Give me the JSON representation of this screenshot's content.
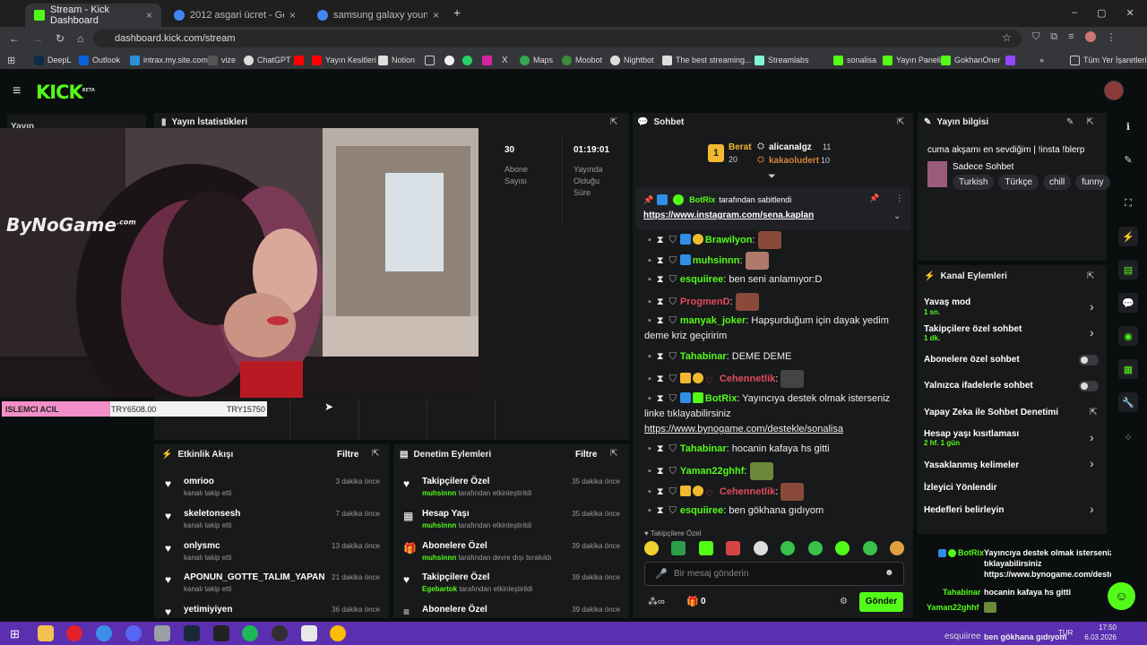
{
  "browser": {
    "tabs": [
      {
        "title": "Stream - Kick Dashboard"
      },
      {
        "title": "2012 asgari ücret - Google'da /"
      },
      {
        "title": "samsung galaxy young - Goog"
      }
    ],
    "url": "dashboard.kick.com/stream",
    "bookmarks": [
      "DeepL",
      "Outlook",
      "intrax.my.site.com",
      "vize",
      "ChatGPT",
      "Yayın Kesitleri",
      "Notion",
      "Maps",
      "Moobot",
      "Nightbot",
      "The best streaming...",
      "Streamlabs",
      "sonalisa",
      "Yayın Paneli",
      "GokhanOner",
      "Tüm Yer İşaretleri"
    ]
  },
  "kick": {
    "logo": "KICK",
    "beta": "BETA"
  },
  "sidebar": {
    "label": "Yayın"
  },
  "stats": {
    "title": "Yayın İstatistikleri",
    "subscribers_value": "30",
    "subscribers_label": "Abone Sayısı",
    "uptime_value": "01:19:01",
    "uptime_label": "Yayında Olduğu Süre"
  },
  "overlay": {
    "brand": "ByNoGame",
    "brand_suffix": ".com",
    "bar_label": "ISLEMCI ACIL",
    "bar_current": "TRY6508.00",
    "bar_goal": "TRY15750",
    "progress": 0.41
  },
  "activity": {
    "title": "Etkinlik Akışı",
    "filter": "Filtre",
    "items": [
      {
        "name": "omrioo",
        "sub": "kanalı takip etti",
        "time": "3 dakika önce"
      },
      {
        "name": "skeletonsesh",
        "sub": "kanalı takip etti",
        "time": "7 dakika önce"
      },
      {
        "name": "onlysmc",
        "sub": "kanalı takip etti",
        "time": "13 dakika önce"
      },
      {
        "name": "APONUN_GOTTE_TALIM_YAPAN",
        "sub": "kanalı takip etti",
        "time": "21 dakika önce"
      },
      {
        "name": "yetimiyiyen",
        "sub": "",
        "time": "36 dakika önce"
      }
    ]
  },
  "moderation": {
    "title": "Denetim Eylemleri",
    "filter": "Filtre",
    "items": [
      {
        "name": "Takipçilere Özel",
        "user": "muhsinnn",
        "sub": "tarafından etkinleştirildi",
        "time": "35 dakika önce"
      },
      {
        "name": "Hesap Yaşı",
        "user": "muhsinnn",
        "sub": "tarafından etkinleştirildi",
        "time": "35 dakika önce"
      },
      {
        "name": "Abonelere Özel",
        "user": "muhsinnn",
        "sub": "tarafından devre dışı bırakıldı",
        "time": "39 dakika önce"
      },
      {
        "name": "Takipçilere Özel",
        "user": "Egebartok",
        "sub": "tarafından etkinleştirildi",
        "time": "39 dakika önce"
      },
      {
        "name": "Abonelere Özel",
        "user": "",
        "sub": "",
        "time": "39 dakika önce"
      }
    ]
  },
  "chat": {
    "title": "Sohbet",
    "top": {
      "first_name": "Berat",
      "first_count": "20",
      "second_name": "alicanalgz",
      "second_count": "11",
      "third_name": "kakaoludert",
      "third_count": "10"
    },
    "pinned_by": "BotRix",
    "pinned_suffix": "tarafından sabitlendi",
    "pinned_link": "https://www.instagram.com/sena.kaplan",
    "messages": [
      {
        "user": "Brawilyon",
        "text": ""
      },
      {
        "user": "muhsinnn",
        "text": ""
      },
      {
        "user": "esquiiree",
        "text": "ben seni anlamıyor:D"
      },
      {
        "user": "ProgmenD",
        "text": ""
      },
      {
        "user": "manyak_joker",
        "text": "Hapşurduğum için dayak yedim deme kriz geçiririm"
      },
      {
        "user": "Tahabinar",
        "text": "DEME DEME"
      },
      {
        "user": "Cehennetlik",
        "text": ""
      },
      {
        "user": "BotRix",
        "text": "Yayıncıya destek olmak isterseniz linke tıklayabilirsiniz",
        "link": "https://www.bynogame.com/destekle/sonalisa"
      },
      {
        "user": "Tahabinar",
        "text": "hocanin kafaya hs gitti"
      },
      {
        "user": "Yaman22ghhf",
        "text": ""
      },
      {
        "user": "Cehennetlik",
        "text": ""
      },
      {
        "user": "esquiiree",
        "text": "ben gökhana gıdıyom"
      }
    ],
    "mode_label": "Takipçilere Özel",
    "input_placeholder": "Bir mesaj gönderin",
    "points": "0",
    "send": "Gönder"
  },
  "stream_info": {
    "title": "Yayın bilgisi",
    "stream_title": "cuma akşamı en sevdiğim | !insta !blerp",
    "category": "Sadece Sohbet",
    "tags": [
      "Turkish",
      "Türkçe",
      "chill",
      "funny"
    ]
  },
  "channel_actions": {
    "title": "Kanal Eylemleri",
    "items": [
      {
        "label": "Yavaş mod",
        "sub": "1 sn."
      },
      {
        "label": "Takipçilere özel sohbet",
        "sub": "1 dk."
      },
      {
        "label": "Abonelere özel sohbet",
        "sub": ""
      },
      {
        "label": "Yalnızca ifadelerle sohbet",
        "sub": ""
      },
      {
        "label": "Yapay Zeka ile Sohbet Denetimi",
        "sub": ""
      },
      {
        "label": "Hesap yaşı kısıtlaması",
        "sub": "2 hf. 1 gün"
      },
      {
        "label": "Yasaklanmış kelimeler",
        "sub": ""
      },
      {
        "label": "İzleyici Yönlendir",
        "sub": ""
      },
      {
        "label": "Hedefleri belirleyin",
        "sub": ""
      }
    ]
  },
  "overlay_chat": {
    "lines": [
      {
        "user": "BotRix",
        "text": "Yayıncıya destek olmak isterseniz linke tıklayabilirsiniz https://www.bynogame.com/destekle/sonalis"
      },
      {
        "user": "Tahabinar",
        "text": "hocanin kafaya hs gitti"
      },
      {
        "user": "Yaman22ghhf",
        "text": ""
      },
      {
        "user": "esquiiree",
        "text": "ben gökhana gıdıyom"
      }
    ]
  },
  "taskbar": {
    "lang": "TUR",
    "time": "17:50",
    "date": "6.03.2026"
  },
  "colors": {
    "accent": "#53fc18",
    "panel": "#18191b",
    "bg": "#0b0e0f",
    "taskbar": "#5a2fb0"
  }
}
